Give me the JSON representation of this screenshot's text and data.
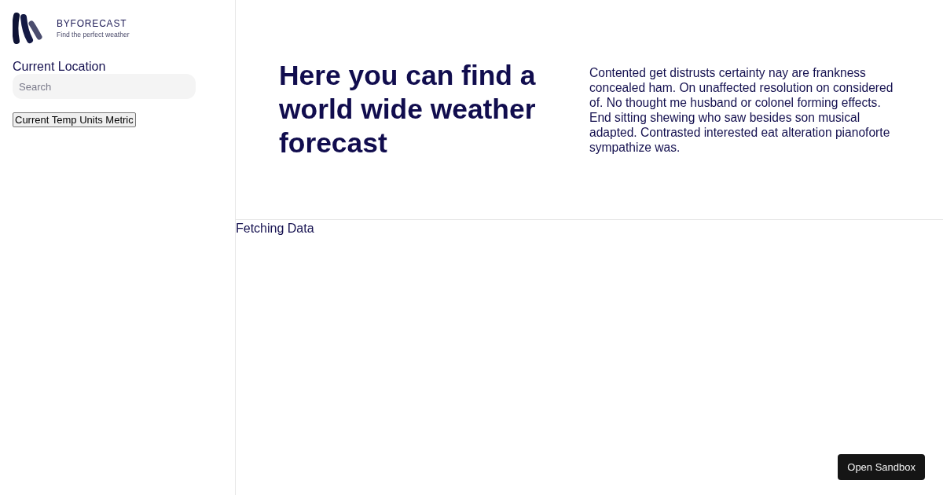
{
  "sidebar": {
    "brand": {
      "name": "BYFORECAST",
      "tagline": "Find the perfect weather"
    },
    "location_label": "Current Location",
    "search": {
      "placeholder": "Search"
    },
    "units_button": "Current Temp Units Metric"
  },
  "hero": {
    "heading": "Here you can find a world wide weather forecast",
    "text": "Contented get distrusts certainty nay are frankness concealed ham. On unaffected resolution on considered of. No thought me husband or colonel forming effects. End sitting shewing who saw besides son musical adapted. Contrasted interested eat alteration pianoforte sympathize was."
  },
  "status": "Fetching Data",
  "sandbox_button": "Open Sandbox"
}
